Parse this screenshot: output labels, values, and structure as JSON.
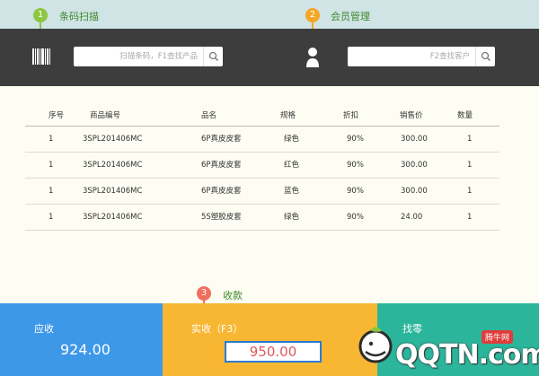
{
  "callouts": {
    "barcode": {
      "num": "1",
      "label": "条码扫描"
    },
    "member": {
      "num": "2",
      "label": "会员管理"
    },
    "checkout": {
      "num": "3",
      "label": "收款"
    }
  },
  "barcode_search": {
    "placeholder": "扫描条码，F1查找产品"
  },
  "member_search": {
    "placeholder": "F2查找客户"
  },
  "table": {
    "headers": [
      "序号",
      "商品编号",
      "品名",
      "规格",
      "折扣",
      "销售价",
      "数量"
    ],
    "rows": [
      [
        "1",
        "3SPL201406MC",
        "6P真皮皮套",
        "绿色",
        "90%",
        "300.00",
        "1"
      ],
      [
        "1",
        "3SPL201406MC",
        "6P真皮皮套",
        "红色",
        "90%",
        "300.00",
        "1"
      ],
      [
        "1",
        "3SPL201406MC",
        "6P真皮皮套",
        "蓝色",
        "90%",
        "300.00",
        "1"
      ],
      [
        "1",
        "3SPL201406MC",
        "5S塑胶皮套",
        "绿色",
        "90%",
        "24.00",
        "1"
      ]
    ]
  },
  "panels": {
    "receivable": {
      "label": "应收",
      "value": "924.00"
    },
    "received": {
      "label": "实收（F3）",
      "value": "950.00"
    },
    "change": {
      "label": "找零"
    }
  },
  "watermark": {
    "text": "QQTN.com",
    "badge": "腾牛网"
  },
  "colors": {
    "topbar": "#3d3d3d",
    "content": "#fdfdf3",
    "blue": "#3e98e8",
    "yellow": "#f7b733",
    "green": "#2bb69b",
    "accent_green": "#8dc63f",
    "accent_orange": "#f5a623",
    "accent_red": "#ef6f5e"
  }
}
